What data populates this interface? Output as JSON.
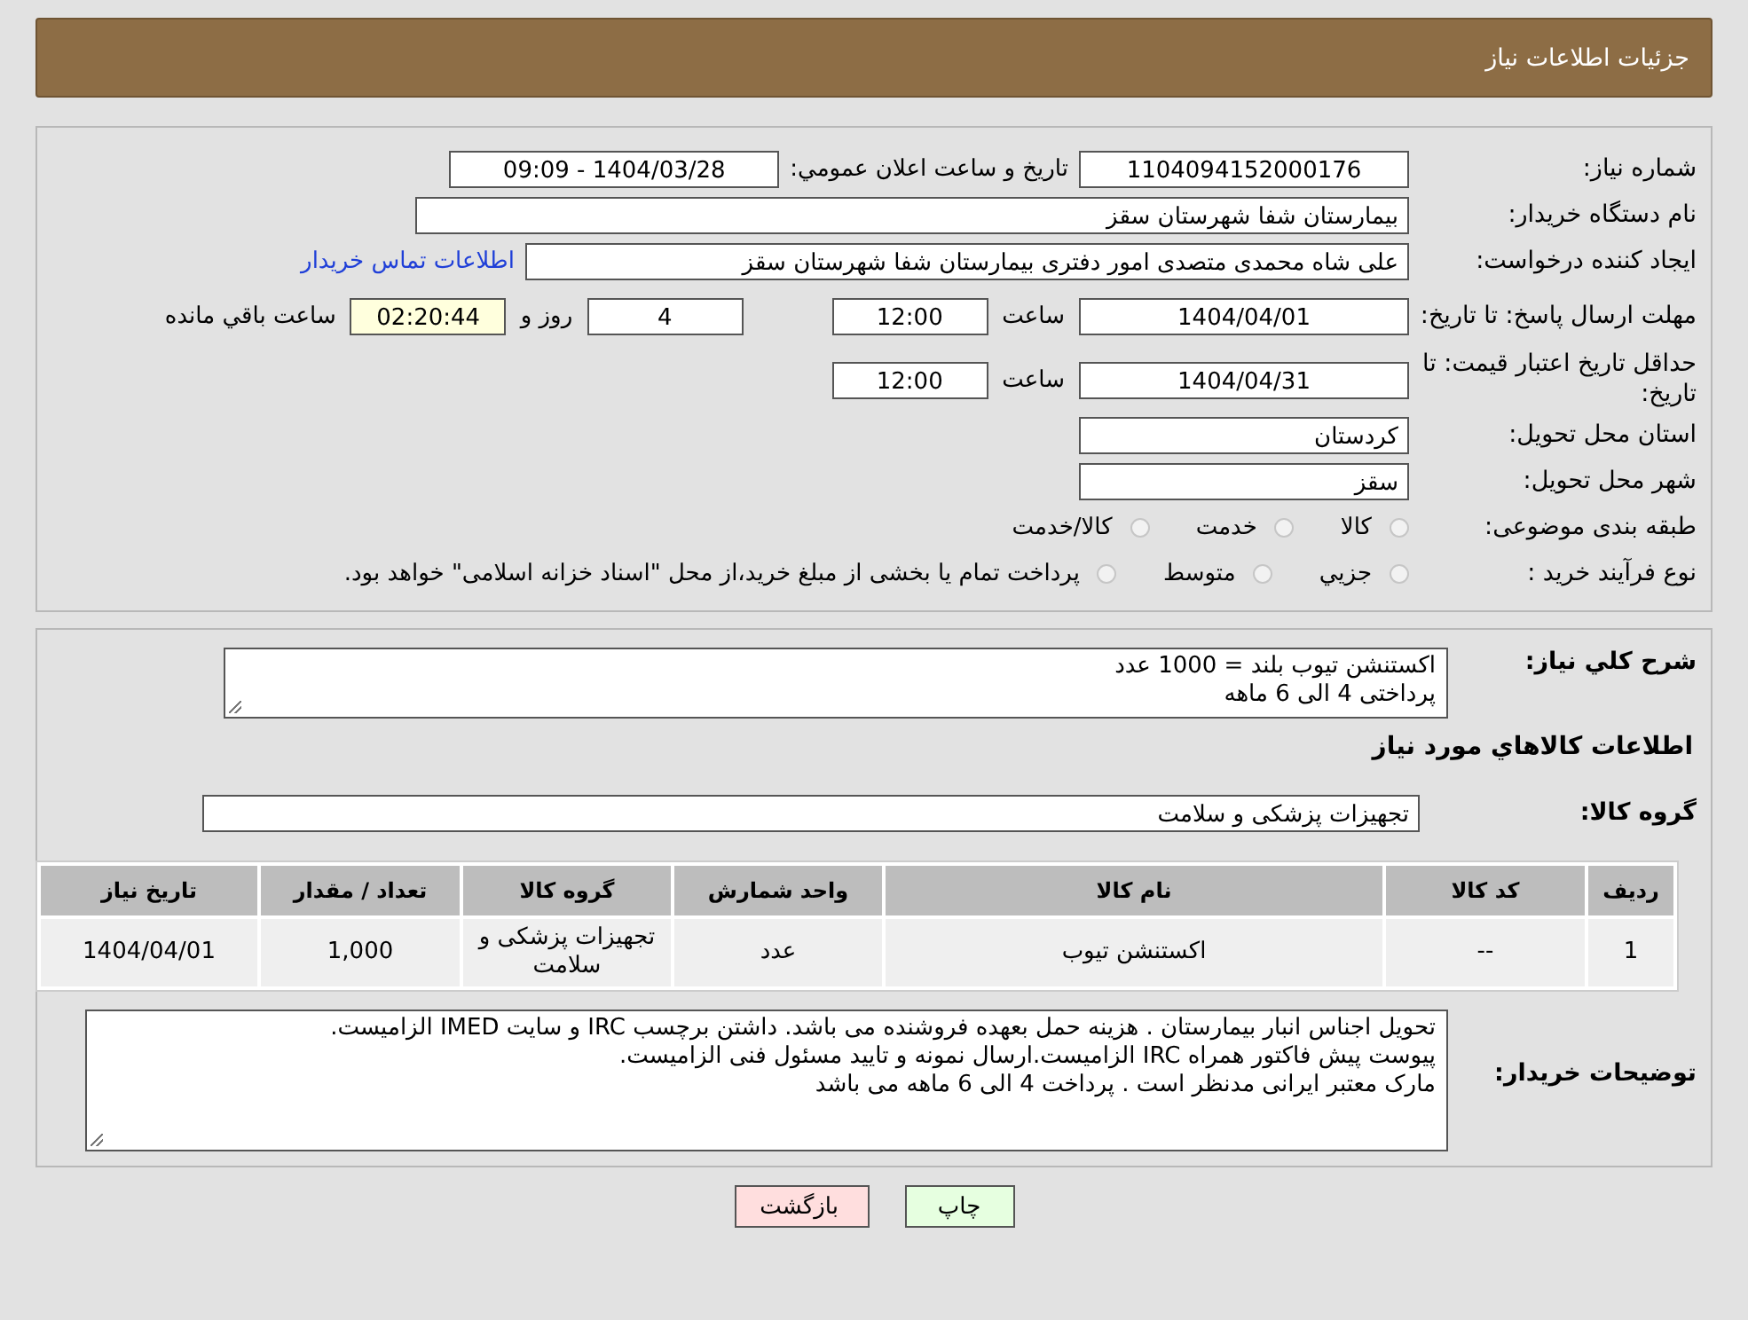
{
  "header": {
    "title": "جزئیات اطلاعات نیاز"
  },
  "details": {
    "need_number": {
      "label": "شماره نیاز:",
      "value": "1104094152000176"
    },
    "announce": {
      "label": "تاریخ و ساعت اعلان عمومي:",
      "value": "1404/03/28 - 09:09"
    },
    "buyer": {
      "label": "نام دستگاه خریدار:",
      "value": "بیمارستان شفا شهرستان سقز"
    },
    "creator": {
      "label": "ایجاد کننده درخواست:",
      "value": "علی شاه محمدی متصدی امور دفتری بیمارستان شفا شهرستان سقز",
      "link": "اطلاعات تماس خریدار"
    },
    "reply_deadline": {
      "label": "مهلت ارسال پاسخ: تا تاریخ:",
      "date": "1404/04/01",
      "time_label": "ساعت",
      "time": "12:00",
      "days": "4",
      "days_label": "روز و",
      "remaining": "02:20:44",
      "remaining_label": "ساعت باقي مانده"
    },
    "price_validity": {
      "label": "حداقل تاریخ اعتبار قیمت: تا تاریخ:",
      "date": "1404/04/31",
      "time_label": "ساعت",
      "time": "12:00"
    },
    "province": {
      "label": "استان محل تحویل:",
      "value": "کردستان"
    },
    "city": {
      "label": "شهر محل تحویل:",
      "value": "سقز"
    },
    "category": {
      "label": "طبقه بندی موضوعی:",
      "options": [
        {
          "label": "کالا",
          "selected": false
        },
        {
          "label": "خدمت",
          "selected": false
        },
        {
          "label": "کالا/خدمت",
          "selected": false
        }
      ]
    },
    "process": {
      "label": "نوع فرآیند خرید :",
      "options": [
        {
          "label": "جزيي",
          "selected": false
        },
        {
          "label": "متوسط",
          "selected": false
        },
        {
          "label": "پرداخت تمام یا بخشی از مبلغ خرید،از محل \"اسناد خزانه اسلامی\" خواهد بود.",
          "selected": false
        }
      ]
    }
  },
  "needs": {
    "summary_label": "شرح کلي نیاز:",
    "summary": "اکستنشن تیوب بلند = 1000 عدد\nپرداختی 4 الی 6 ماهه",
    "goods_heading": "اطلاعات کالاهاي مورد نیاز",
    "group_label": "گروه کالا:",
    "group": "تجهیزات پزشکی و سلامت",
    "table": {
      "columns": [
        "ردیف",
        "کد کالا",
        "نام کالا",
        "واحد شمارش",
        "گروه کالا",
        "تعداد / مقدار",
        "تاریخ نیاز"
      ],
      "rows": [
        [
          "1",
          "--",
          "اکستنشن تیوب",
          "عدد",
          "تجهیزات پزشکی و سلامت",
          "1,000",
          "1404/04/01"
        ]
      ]
    },
    "notes_label": "توضیحات خریدار:",
    "notes": "تحویل اجناس  انبار بیمارستان . هزینه حمل بعهده فروشنده می باشد.  داشتن برچسب IRC  و سایت  IMED  الزامیست.\nپیوست پیش فاکتور همراه IRC  الزامیست.ارسال نمونه و تایید مسئول فنی الزامیست.\n مارک معتبر ایرانی مدنظر است . پرداخت 4 الی 6 ماهه می باشد"
  },
  "buttons": [
    {
      "label": "چاپ",
      "kind": "print"
    },
    {
      "label": "بازگشت",
      "kind": "back"
    }
  ]
}
